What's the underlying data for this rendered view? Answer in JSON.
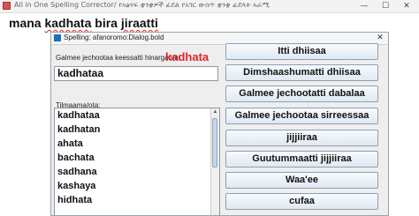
{
  "window": {
    "title": "All in One Spelling Corrector/ የአፅናፍ ቋንቋዎች ፊደል የአገር ውስጥ ቋንቋ ፊደላት አራሚ",
    "minimize_glyph": "—",
    "maximize_glyph": "☐",
    "close_glyph": "✕"
  },
  "editor": {
    "words": [
      "mana",
      "kadhata",
      "bira",
      "jiraatti"
    ],
    "misspelled_index": 1
  },
  "dialog": {
    "title": "Spelling: afanoromo:Dialog.bold",
    "close_glyph": "✕",
    "not_found_label": "Galmee jechootaa keessatti hinargamu:",
    "not_found_word": "kadhata",
    "word_field_value": "kadhataa",
    "suggestions_label": "Tilmaama/ota:",
    "suggestions": [
      "kadhataa",
      "kadhatan",
      "ahata",
      "bachata",
      "sadhana",
      "kashaya",
      "hidhata"
    ],
    "buttons": {
      "ignore": "Itti dhiisaa",
      "ignore_all": "Dimshaashumatti dhiisaa",
      "add": "Galmee jechootatti dabalaa",
      "save_dictionary": "Galmee jechootaa sirreessaa",
      "change": "jijjiiraa",
      "change_all": "Guutummaatti jijjiiraa",
      "undo": "Waa'ee",
      "close": "cufaa"
    }
  }
}
